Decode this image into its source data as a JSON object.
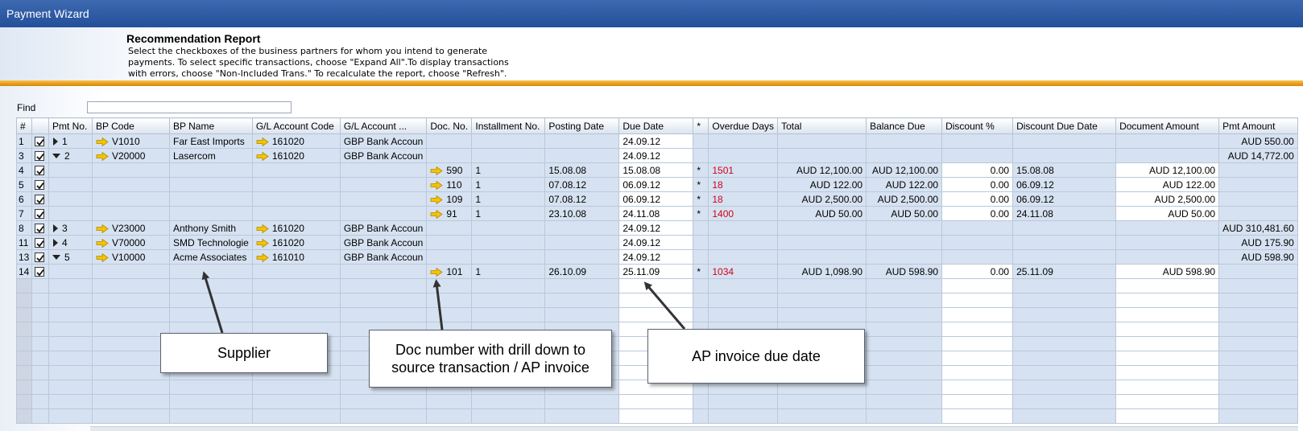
{
  "window": {
    "title": "Payment Wizard"
  },
  "report": {
    "title": "Recommendation Report",
    "description": [
      "Select the checkboxes of the business partners for whom you intend to generate",
      "payments. To select specific transactions, choose \"Expand All\".To display transactions",
      "with errors, choose \"Non-Included Trans.\" To recalculate the report, choose \"Refresh\"."
    ]
  },
  "find": {
    "label": "Find",
    "value": ""
  },
  "columns": [
    "#",
    "",
    "Pmt No.",
    "BP Code",
    "BP Name",
    "G/L Account Code",
    "G/L Account ...",
    "Doc. No.",
    "Installment No.",
    "Posting Date",
    "Due Date",
    "*",
    "Overdue Days",
    "Total",
    "Balance Due",
    "Discount %",
    "Discount Due Date",
    "Document Amount",
    "Pmt Amount"
  ],
  "rows": [
    {
      "n": "1",
      "checked": true,
      "expand": "collapsed",
      "pmt": "1",
      "bp_code": "V1010",
      "bp_name": "Far East Imports",
      "gl_code": "161020",
      "gl_name": "GBP Bank Accoun",
      "doc": "",
      "inst": "",
      "posting": "",
      "due": "24.09.12",
      "star": "",
      "overdue": "",
      "total": "",
      "balance": "",
      "disc": "",
      "disc_due": "",
      "doc_amt": "",
      "pmt_amt": "AUD 550.00"
    },
    {
      "n": "3",
      "checked": true,
      "expand": "expanded",
      "pmt": "2",
      "bp_code": "V20000",
      "bp_name": "Lasercom",
      "gl_code": "161020",
      "gl_name": "GBP Bank Accoun",
      "doc": "",
      "inst": "",
      "posting": "",
      "due": "24.09.12",
      "star": "",
      "overdue": "",
      "total": "",
      "balance": "",
      "disc": "",
      "disc_due": "",
      "doc_amt": "",
      "pmt_amt": "AUD 14,772.00"
    },
    {
      "n": "4",
      "checked": true,
      "expand": "",
      "pmt": "",
      "bp_code": "",
      "bp_name": "",
      "gl_code": "",
      "gl_name": "",
      "doc": "590",
      "inst": "1",
      "posting": "15.08.08",
      "due": "15.08.08",
      "star": "*",
      "overdue": "1501",
      "total": "AUD 12,100.00",
      "balance": "AUD 12,100.00",
      "disc": "0.00",
      "disc_due": "15.08.08",
      "doc_amt": "AUD 12,100.00",
      "pmt_amt": ""
    },
    {
      "n": "5",
      "checked": true,
      "expand": "",
      "pmt": "",
      "bp_code": "",
      "bp_name": "",
      "gl_code": "",
      "gl_name": "",
      "doc": "110",
      "inst": "1",
      "posting": "07.08.12",
      "due": "06.09.12",
      "star": "*",
      "overdue": "18",
      "total": "AUD 122.00",
      "balance": "AUD 122.00",
      "disc": "0.00",
      "disc_due": "06.09.12",
      "doc_amt": "AUD 122.00",
      "pmt_amt": ""
    },
    {
      "n": "6",
      "checked": true,
      "expand": "",
      "pmt": "",
      "bp_code": "",
      "bp_name": "",
      "gl_code": "",
      "gl_name": "",
      "doc": "109",
      "inst": "1",
      "posting": "07.08.12",
      "due": "06.09.12",
      "star": "*",
      "overdue": "18",
      "total": "AUD 2,500.00",
      "balance": "AUD 2,500.00",
      "disc": "0.00",
      "disc_due": "06.09.12",
      "doc_amt": "AUD 2,500.00",
      "pmt_amt": ""
    },
    {
      "n": "7",
      "checked": true,
      "expand": "",
      "pmt": "",
      "bp_code": "",
      "bp_name": "",
      "gl_code": "",
      "gl_name": "",
      "doc": "91",
      "inst": "1",
      "posting": "23.10.08",
      "due": "24.11.08",
      "star": "*",
      "overdue": "1400",
      "total": "AUD 50.00",
      "balance": "AUD 50.00",
      "disc": "0.00",
      "disc_due": "24.11.08",
      "doc_amt": "AUD 50.00",
      "pmt_amt": ""
    },
    {
      "n": "8",
      "checked": true,
      "expand": "collapsed",
      "pmt": "3",
      "bp_code": "V23000",
      "bp_name": "Anthony Smith",
      "gl_code": "161020",
      "gl_name": "GBP Bank Accoun",
      "doc": "",
      "inst": "",
      "posting": "",
      "due": "24.09.12",
      "star": "",
      "overdue": "",
      "total": "",
      "balance": "",
      "disc": "",
      "disc_due": "",
      "doc_amt": "",
      "pmt_amt": "AUD 310,481.60"
    },
    {
      "n": "11",
      "checked": true,
      "expand": "collapsed",
      "pmt": "4",
      "bp_code": "V70000",
      "bp_name": "SMD Technologie",
      "gl_code": "161020",
      "gl_name": "GBP Bank Accoun",
      "doc": "",
      "inst": "",
      "posting": "",
      "due": "24.09.12",
      "star": "",
      "overdue": "",
      "total": "",
      "balance": "",
      "disc": "",
      "disc_due": "",
      "doc_amt": "",
      "pmt_amt": "AUD 175.90"
    },
    {
      "n": "13",
      "checked": true,
      "expand": "expanded",
      "pmt": "5",
      "bp_code": "V10000",
      "bp_name": "Acme Associates",
      "gl_code": "161010",
      "gl_name": "GBP Bank Accoun",
      "doc": "",
      "inst": "",
      "posting": "",
      "due": "24.09.12",
      "star": "",
      "overdue": "",
      "total": "",
      "balance": "",
      "disc": "",
      "disc_due": "",
      "doc_amt": "",
      "pmt_amt": "AUD 598.90"
    },
    {
      "n": "14",
      "checked": true,
      "expand": "",
      "pmt": "",
      "bp_code": "",
      "bp_name": "",
      "gl_code": "",
      "gl_name": "",
      "doc": "101",
      "inst": "1",
      "posting": "26.10.09",
      "due": "25.11.09",
      "star": "*",
      "overdue": "1034",
      "total": "AUD 1,098.90",
      "balance": "AUD 598.90",
      "disc": "0.00",
      "disc_due": "25.11.09",
      "doc_amt": "AUD 598.90",
      "pmt_amt": ""
    }
  ],
  "empty_rows": 10,
  "callouts": {
    "supplier": "Supplier",
    "doc_line1": "Doc number with drill down to",
    "doc_line2": "source transaction / AP invoice",
    "due": "AP invoice due date"
  },
  "colors": {
    "titlebar": "#2e5aa3",
    "grid_cell": "#d6e2f1",
    "overdue_red": "#d0021b",
    "accent_orange": "#e89b12",
    "link_arrow": "#f5c400"
  }
}
